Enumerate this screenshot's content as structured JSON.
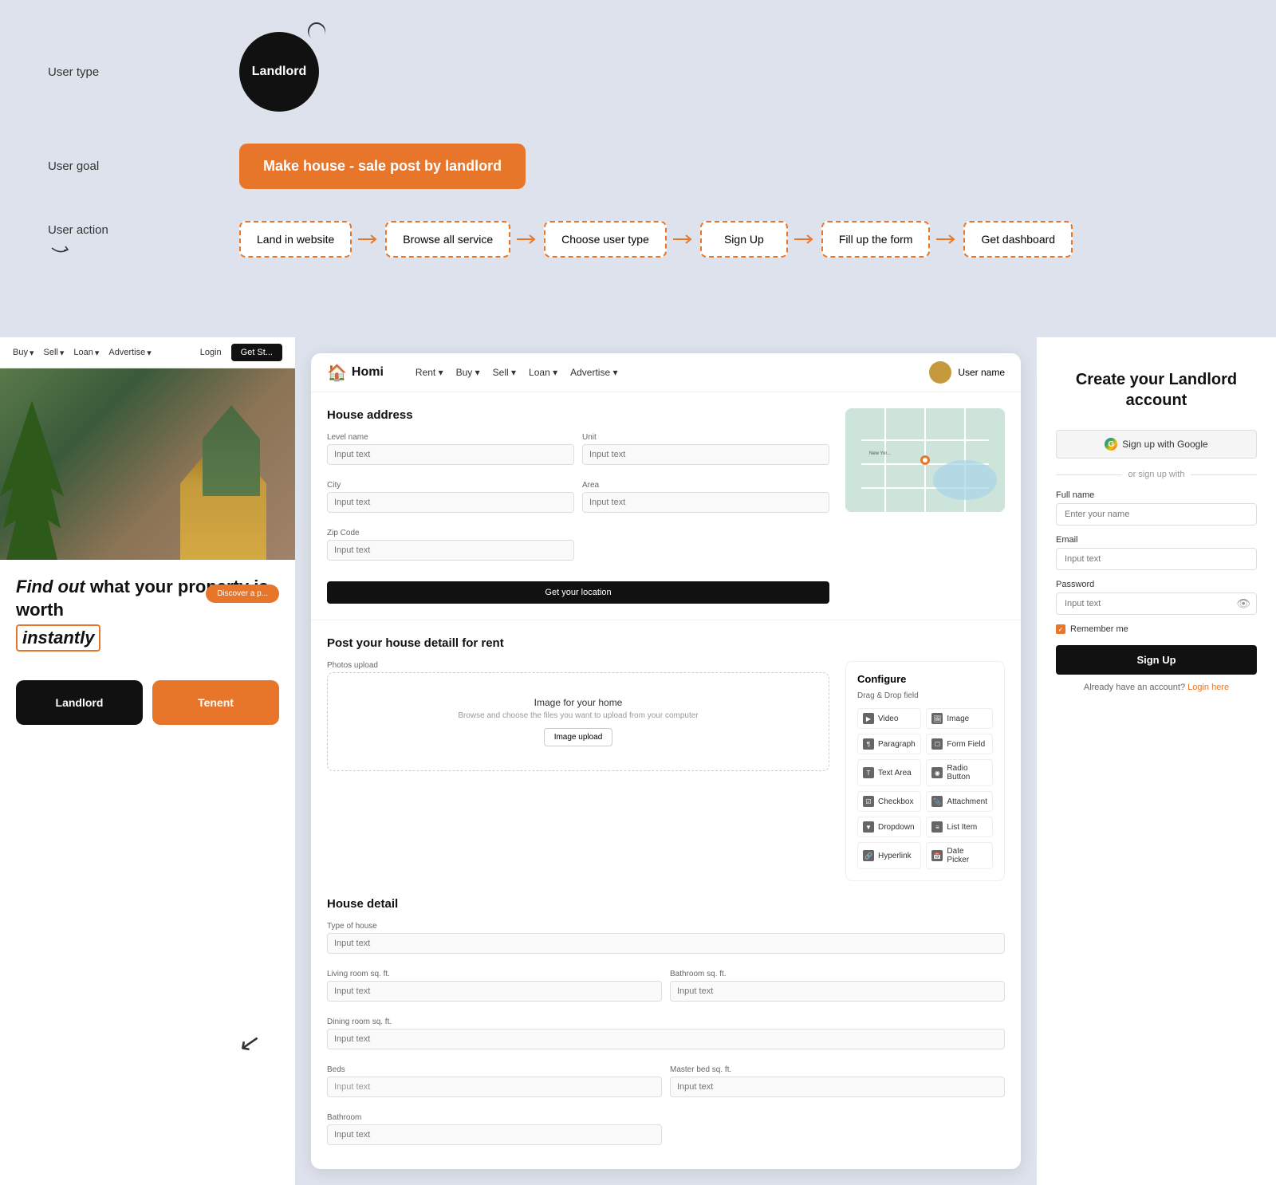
{
  "top": {
    "user_type_label": "User type",
    "landlord_label": "Landlord",
    "user_goal_label": "User goal",
    "goal_text": "Make house - sale post by landlord",
    "user_action_label": "User action",
    "action_steps": [
      "Land in website",
      "Browse all service",
      "Choose user type",
      "Sign Up",
      "Fill up the form",
      "Get dashboard"
    ]
  },
  "left_panel": {
    "nav_items": [
      "Buy",
      "Sell",
      "Loan",
      "Advertise"
    ],
    "login_label": "Login",
    "get_started_label": "Get St...",
    "hero_title_part1": "Find out",
    "hero_title_part2": "what your property is worth",
    "instantly_label": "instantly",
    "discover_label": "Discover a p...",
    "landlord_btn": "Landlord",
    "tenant_btn": "Tenent"
  },
  "form_panel": {
    "logo": "Homi",
    "nav_links": [
      "Rent",
      "Buy",
      "Sell",
      "Loan",
      "Advertise"
    ],
    "user_name": "User name",
    "house_address_title": "House address",
    "level_name_label": "Level name",
    "unit_label": "Unit",
    "city_label": "City",
    "area_label": "Area",
    "zip_label": "Zip Code",
    "input_placeholder": "Input text",
    "location_btn": "Get your location",
    "post_title": "Post your house detaill for rent",
    "photos_label": "Photos upload",
    "upload_title": "Image for your home",
    "upload_desc": "Browse and choose the files you want to upload from your computer",
    "upload_btn": "Image upload",
    "configure_title": "Configure",
    "drag_drop_label": "Drag & Drop field",
    "config_items": [
      {
        "icon": "▶",
        "label": "Video"
      },
      {
        "icon": "☐",
        "label": "Image"
      },
      {
        "icon": "¶",
        "label": "Paragraph"
      },
      {
        "icon": "☐",
        "label": "Form Field"
      },
      {
        "icon": "T",
        "label": "Text Area"
      },
      {
        "icon": "◉",
        "label": "Radio Button"
      },
      {
        "icon": "☑",
        "label": "Checkbox"
      },
      {
        "icon": "📎",
        "label": "Attachment"
      },
      {
        "icon": "▼",
        "label": "Dropdown"
      },
      {
        "icon": "≡",
        "label": "List Item"
      },
      {
        "icon": "🔗",
        "label": "Hyperlink"
      },
      {
        "icon": "📅",
        "label": "Date Picker"
      }
    ],
    "house_detail_title": "House detail",
    "type_label": "Type of house",
    "living_label": "Living room sq. ft.",
    "bathroom_label": "Bathroom sq. ft.",
    "dining_label": "Dining room sq. ft.",
    "beds_label": "Beds",
    "master_bed_label": "Master bed sq. ft.",
    "bathroom2_label": "Bathroom"
  },
  "signup_panel": {
    "title": "Create your Landlord account",
    "google_btn": "Sign up with Google",
    "divider_text": "or sign up with",
    "full_name_label": "Full name",
    "full_name_placeholder": "Enter your name",
    "email_label": "Email",
    "email_placeholder": "Input text",
    "password_label": "Password",
    "password_placeholder": "Input text",
    "remember_label": "Remember me",
    "signup_btn": "Sign Up",
    "already_text": "Already have an account?",
    "login_link": "Login here"
  },
  "colors": {
    "orange": "#e8762a",
    "dark": "#111111",
    "bg": "#dde2ec",
    "white": "#ffffff"
  }
}
